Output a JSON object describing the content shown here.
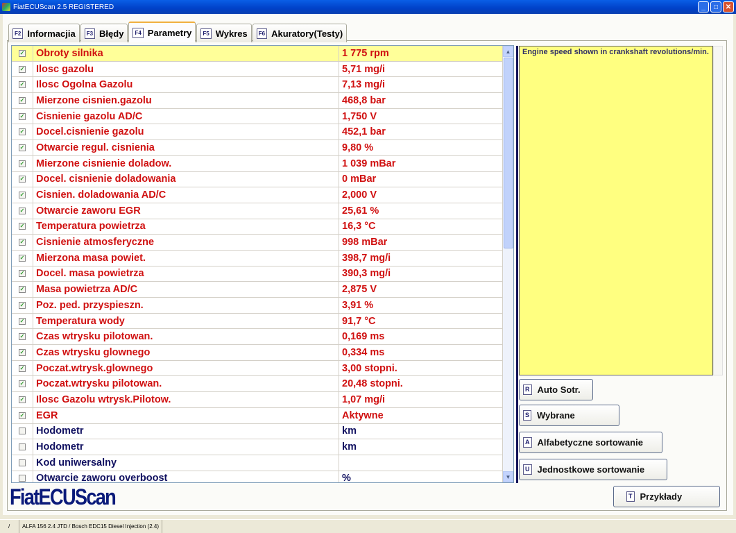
{
  "window": {
    "title": "FiatECUScan 2.5 REGISTERED"
  },
  "tabs": [
    {
      "key": "F2",
      "label": "Informacjia"
    },
    {
      "key": "F3",
      "label": "Błędy"
    },
    {
      "key": "F4",
      "label": "Parametry"
    },
    {
      "key": "F5",
      "label": "Wykres"
    },
    {
      "key": "F6",
      "label": "Akuratory(Testy)"
    }
  ],
  "params": [
    {
      "checked": true,
      "name": "Obroty silnika",
      "value": "1 775 rpm",
      "selected": true
    },
    {
      "checked": true,
      "name": "Ilosc gazolu",
      "value": "5,71 mg/i"
    },
    {
      "checked": true,
      "name": "Ilosc Ogolna Gazolu",
      "value": "7,13 mg/i"
    },
    {
      "checked": true,
      "name": "Mierzone cisnien.gazolu",
      "value": "468,8 bar"
    },
    {
      "checked": true,
      "name": "Cisnienie gazolu AD/C",
      "value": "1,750 V"
    },
    {
      "checked": true,
      "name": "Docel.cisnienie gazolu",
      "value": "452,1 bar"
    },
    {
      "checked": true,
      "name": "Otwarcie regul. cisnienia",
      "value": "9,80 %"
    },
    {
      "checked": true,
      "name": "Mierzone cisnienie doladow.",
      "value": "1 039 mBar"
    },
    {
      "checked": true,
      "name": "Docel. cisnienie doladowania",
      "value": "0 mBar"
    },
    {
      "checked": true,
      "name": "Cisnien. doladowania AD/C",
      "value": "2,000 V"
    },
    {
      "checked": true,
      "name": "Otwarcie zaworu EGR",
      "value": "25,61 %"
    },
    {
      "checked": true,
      "name": "Temperatura powietrza",
      "value": "16,3 °C"
    },
    {
      "checked": true,
      "name": "Cisnienie atmosferyczne",
      "value": "998 mBar"
    },
    {
      "checked": true,
      "name": "Mierzona masa powiet.",
      "value": "398,7 mg/i"
    },
    {
      "checked": true,
      "name": "Docel. masa powietrza",
      "value": "390,3 mg/i"
    },
    {
      "checked": true,
      "name": "Masa powietrza AD/C",
      "value": "2,875 V"
    },
    {
      "checked": true,
      "name": "Poz. ped. przyspieszn.",
      "value": "3,91 %"
    },
    {
      "checked": true,
      "name": "Temperatura wody",
      "value": "91,7 °C"
    },
    {
      "checked": true,
      "name": "Czas wtrysku pilotowan.",
      "value": "0,169 ms"
    },
    {
      "checked": true,
      "name": "Czas wtrysku glownego",
      "value": "0,334 ms"
    },
    {
      "checked": true,
      "name": "Poczat.wtrysk.glownego",
      "value": "3,00  stopni."
    },
    {
      "checked": true,
      "name": "Poczat.wtrysku pilotowan.",
      "value": "20,48  stopni."
    },
    {
      "checked": true,
      "name": "Ilosc Gazolu wtrysk.Pilotow.",
      "value": "1,07 mg/i"
    },
    {
      "checked": true,
      "name": "EGR",
      "value": "Aktywne"
    },
    {
      "checked": false,
      "name": "Hodometr",
      "value": " km"
    },
    {
      "checked": false,
      "name": "Hodometr",
      "value": " km"
    },
    {
      "checked": false,
      "name": "Kod uniwersalny",
      "value": ""
    },
    {
      "checked": false,
      "name": "Otwarcie zaworu overboost",
      "value": "%"
    }
  ],
  "description": "Engine speed shown in crankshaft revolutions/min.",
  "buttons": {
    "auto": {
      "key": "R",
      "label": "Auto Sotr."
    },
    "wybrane": {
      "key": "S",
      "label": "Wybrane"
    },
    "alfa": {
      "key": "A",
      "label": "Alfabetyczne sortowanie"
    },
    "jedn": {
      "key": "U",
      "label": "Jednostkowe sortowanie"
    },
    "przyklady": {
      "key": "T",
      "label": "Przykłady"
    }
  },
  "logo": "FiatECUScan",
  "status": {
    "icon": "/",
    "vehicle": "ALFA 156 2.4 JTD / Bosch EDC15 Diesel Injection (2.4)"
  },
  "colors": {
    "checked_param": "#d01010",
    "unchecked_param": "#101060",
    "selected_row": "#ffff99"
  }
}
